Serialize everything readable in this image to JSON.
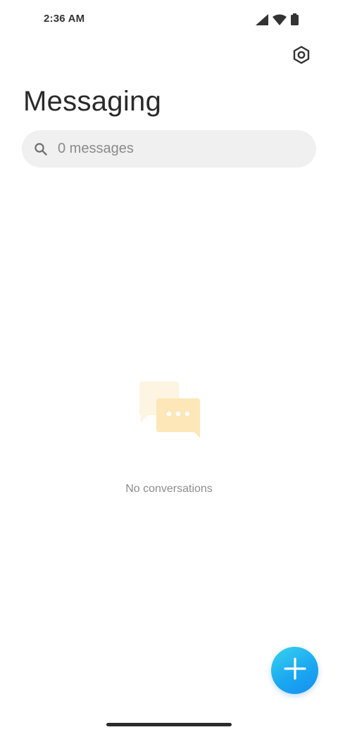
{
  "status_bar": {
    "time": "2:36 AM",
    "icons": [
      "signal-icon",
      "wifi-icon",
      "battery-icon"
    ]
  },
  "header": {
    "settings_icon": "settings-icon",
    "title": "Messaging"
  },
  "search": {
    "icon": "search-icon",
    "placeholder": "0 messages"
  },
  "empty_state": {
    "illustration": "chat-bubbles-icon",
    "text": "No conversations"
  },
  "fab": {
    "icon": "plus-icon",
    "color_start": "#3ad3f0",
    "color_end": "#168ff0"
  },
  "colors": {
    "background": "#ffffff",
    "search_background": "#f0f0f0",
    "illustration_back": "#fdf3df",
    "illustration_front": "#fde6b6"
  }
}
